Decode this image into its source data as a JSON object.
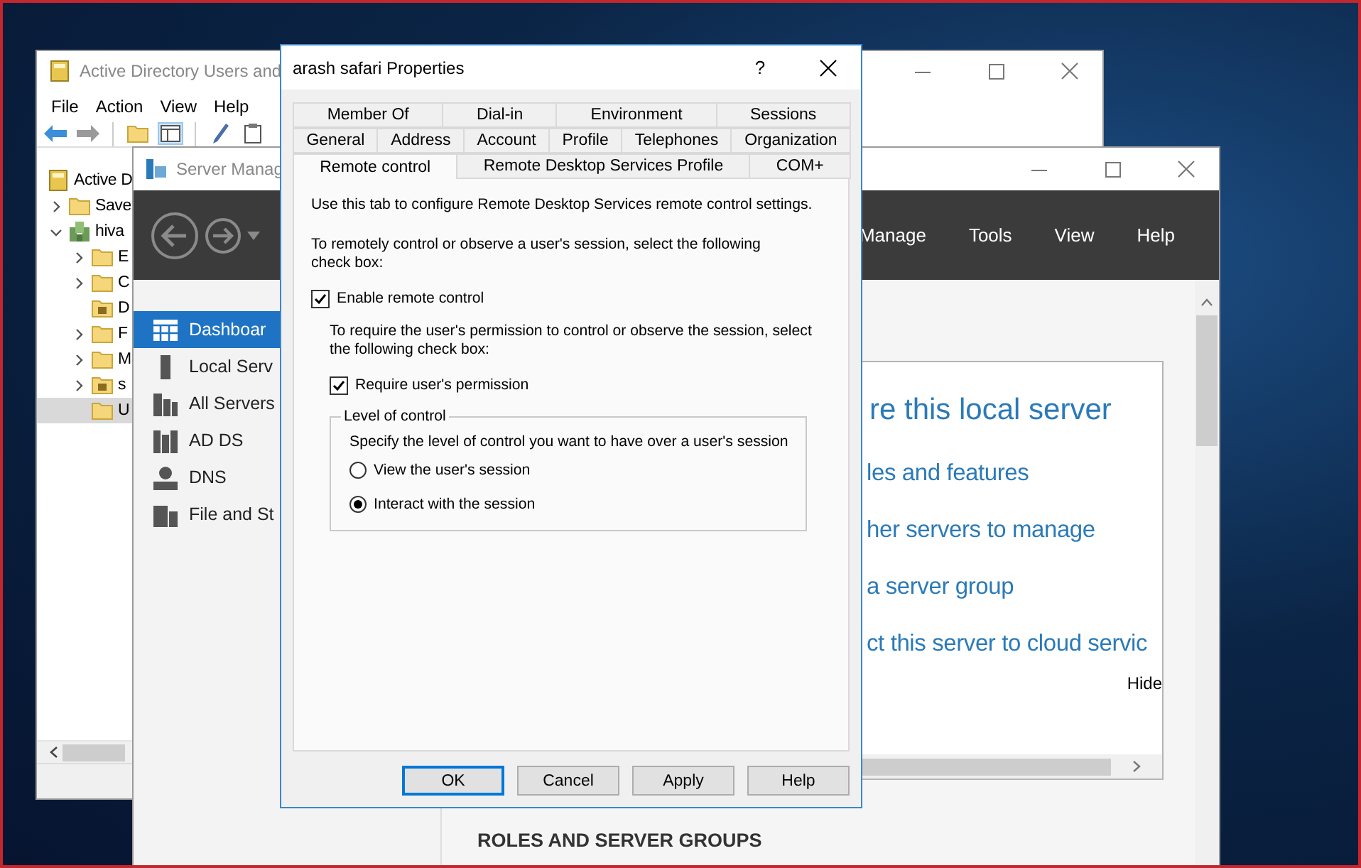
{
  "ad_window": {
    "title": "Active Directory Users and",
    "menu": [
      "File",
      "Action",
      "View",
      "Help"
    ],
    "tree": [
      {
        "label": "Active D",
        "kind": "root",
        "selected": false,
        "children": [
          {
            "label": "Save",
            "kind": "folder",
            "expanded": false,
            "selected": false
          },
          {
            "label": "hiva",
            "kind": "domain",
            "expanded": true,
            "selected": false,
            "children": [
              {
                "label": "E",
                "kind": "folder",
                "expanded": false,
                "selected": false
              },
              {
                "label": "C",
                "kind": "folder",
                "expanded": false,
                "selected": false
              },
              {
                "label": "D",
                "kind": "special",
                "selected": false
              },
              {
                "label": "F",
                "kind": "folder",
                "expanded": false,
                "selected": false
              },
              {
                "label": "M",
                "kind": "folder",
                "expanded": false,
                "selected": false
              },
              {
                "label": "s",
                "kind": "special",
                "expanded": false,
                "selected": false
              },
              {
                "label": "U",
                "kind": "folder",
                "selected": true
              }
            ]
          }
        ]
      }
    ]
  },
  "server_manager": {
    "title": "Server Manag",
    "menu": [
      "Manage",
      "Tools",
      "View",
      "Help"
    ],
    "nav": [
      {
        "label": "Dashboar",
        "kind": "dashboard",
        "selected": true
      },
      {
        "label": "Local Serv",
        "kind": "server",
        "selected": false
      },
      {
        "label": "All Servers",
        "kind": "servers",
        "selected": false
      },
      {
        "label": "AD DS",
        "kind": "adds",
        "selected": false
      },
      {
        "label": "DNS",
        "kind": "dns",
        "selected": false
      },
      {
        "label": "File and St",
        "kind": "files",
        "selected": false
      }
    ],
    "welcome": {
      "heading": "re this local server",
      "links": [
        "les and features",
        "her servers to manage",
        "a server group",
        "ct this server to cloud servic"
      ],
      "hide": "Hide"
    },
    "section_heading": "ROLES AND SERVER GROUPS"
  },
  "dialog": {
    "title": "arash safari Properties",
    "help": "?",
    "tab_rows": [
      [
        {
          "label": "Member Of",
          "selected": false
        },
        {
          "label": "Dial-in",
          "selected": false
        },
        {
          "label": "Environment",
          "selected": false
        },
        {
          "label": "Sessions",
          "selected": false
        }
      ],
      [
        {
          "label": "General",
          "selected": false
        },
        {
          "label": "Address",
          "selected": false
        },
        {
          "label": "Account",
          "selected": false
        },
        {
          "label": "Profile",
          "selected": false
        },
        {
          "label": "Telephones",
          "selected": false
        },
        {
          "label": "Organization",
          "selected": false
        }
      ],
      [
        {
          "label": "Remote control",
          "selected": true
        },
        {
          "label": "Remote Desktop Services Profile",
          "selected": false
        },
        {
          "label": "COM+",
          "selected": false
        }
      ]
    ],
    "intro": "Use this tab to configure Remote Desktop Services remote control settings.",
    "instruction": "To remotely control or observe a user's session, select the following\ncheck box:",
    "enable": {
      "label": "Enable remote control",
      "checked": true
    },
    "permission_note": "To require the user's permission to control or observe the session, select\nthe following check box:",
    "permission": {
      "label": "Require user's permission",
      "checked": true
    },
    "level_group": {
      "title": "Level of control",
      "prompt": "Specify the level of control you want to have over a user's session",
      "options": [
        {
          "label": "View the user's session",
          "selected": false
        },
        {
          "label": "Interact with the session",
          "selected": true
        }
      ]
    },
    "buttons": [
      {
        "label": "OK",
        "default": true
      },
      {
        "label": "Cancel",
        "default": false
      },
      {
        "label": "Apply",
        "default": false
      },
      {
        "label": "Help",
        "default": false
      }
    ]
  }
}
